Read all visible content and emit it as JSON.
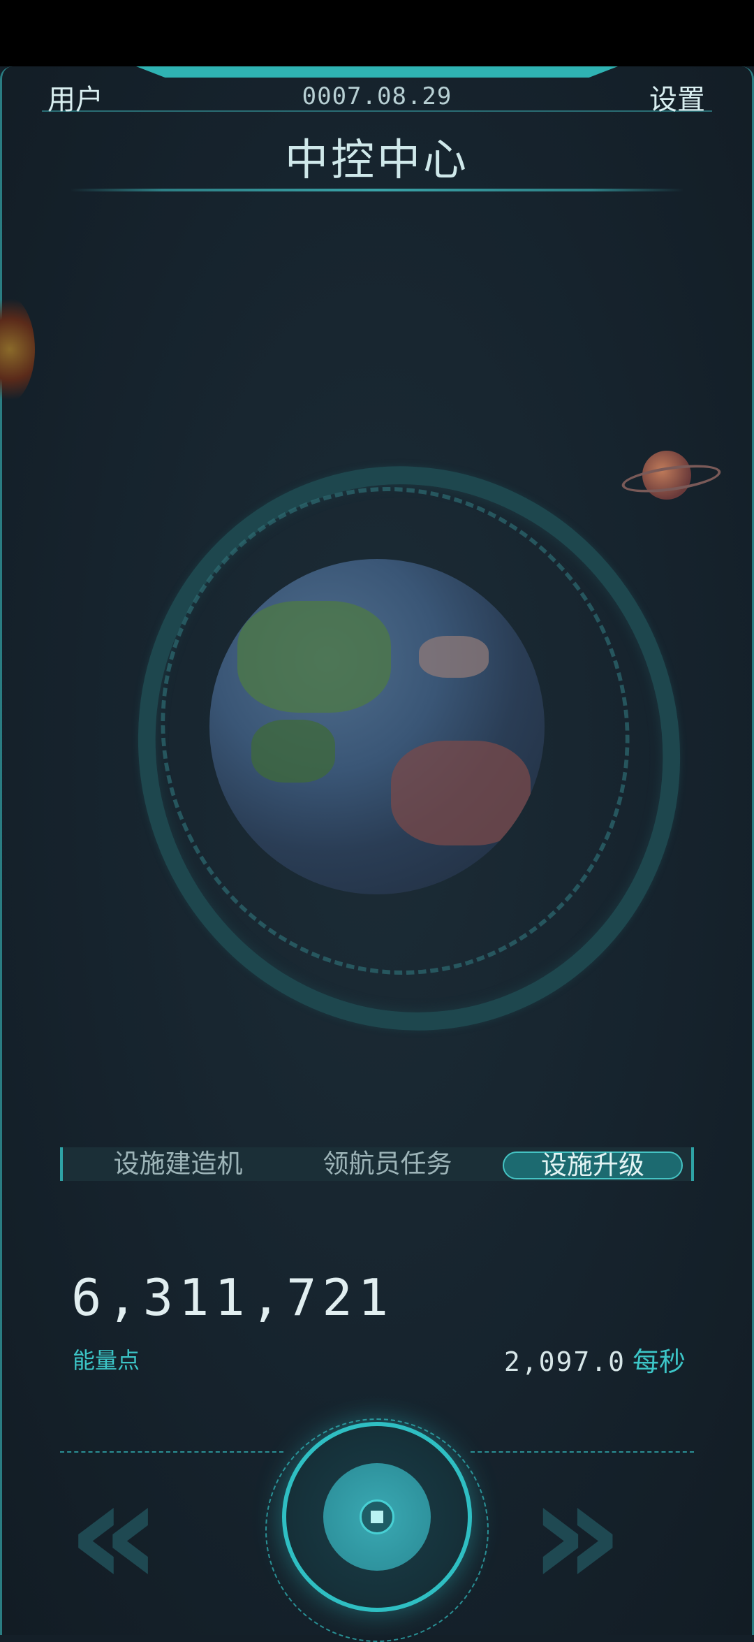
{
  "header": {
    "user_label": "用户",
    "date": "0007.08.29",
    "settings_label": "设置",
    "title": "中控中心"
  },
  "tabs": [
    {
      "label": "设施建造机",
      "active": false
    },
    {
      "label": "领航员任务",
      "active": false
    },
    {
      "label": "设施升级",
      "active": true
    }
  ],
  "energy": {
    "value": "6,311,721",
    "label": "能量点",
    "rate_value": "2,097.0",
    "rate_unit": "每秒"
  },
  "colors": {
    "accent": "#2fbfc3",
    "background": "#141f28",
    "accent_text": "#3cc5c7"
  },
  "icons": {
    "prev": "double-chevron-left-icon",
    "next": "double-chevron-right-icon",
    "center": "power-core-icon"
  }
}
